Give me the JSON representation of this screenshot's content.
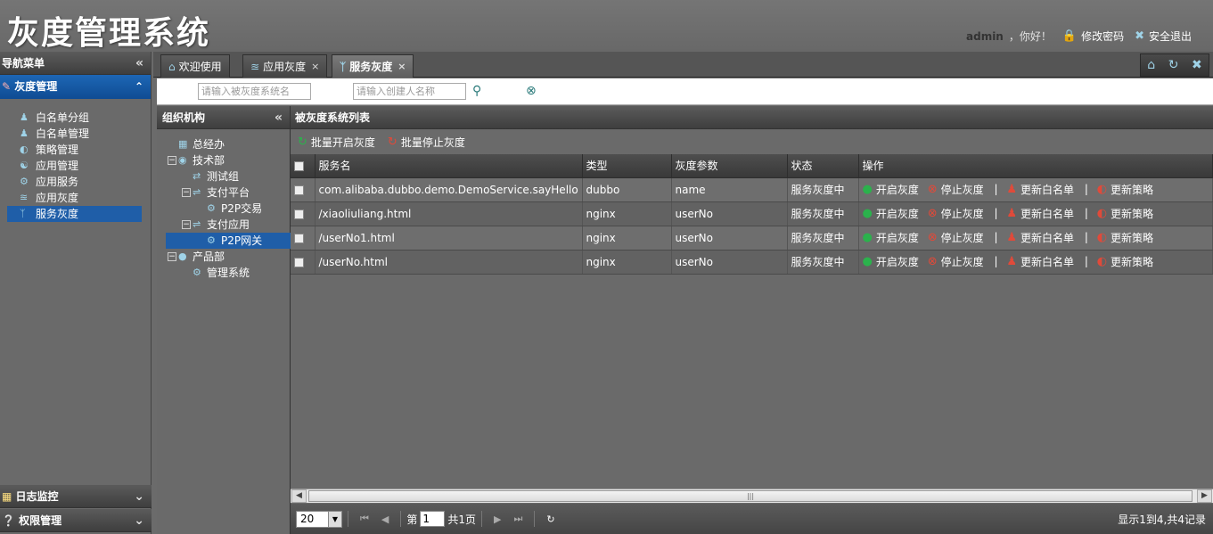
{
  "app": {
    "title": "灰度管理系统"
  },
  "user": {
    "name": "admin",
    "greeting": "，你好！",
    "change_password": "修改密码",
    "logout": "安全退出"
  },
  "nav": {
    "title": "导航菜单",
    "active_group": "灰度管理",
    "items": [
      {
        "label": "白名单分组",
        "icon": "users-icon"
      },
      {
        "label": "白名单管理",
        "icon": "people-icon"
      },
      {
        "label": "策略管理",
        "icon": "strategy-icon"
      },
      {
        "label": "应用管理",
        "icon": "globe-icon"
      },
      {
        "label": "应用服务",
        "icon": "service-icon"
      },
      {
        "label": "应用灰度",
        "icon": "rss-icon"
      },
      {
        "label": "服务灰度",
        "icon": "bluetooth-icon"
      }
    ],
    "bottom_groups": [
      {
        "label": "日志监控",
        "icon": "table-icon"
      },
      {
        "label": "权限管理",
        "icon": "help-icon"
      }
    ]
  },
  "tabs": [
    {
      "label": "欢迎使用",
      "icon": "home-icon"
    },
    {
      "label": "应用灰度",
      "icon": "rss-icon"
    },
    {
      "label": "服务灰度",
      "icon": "bluetooth-icon"
    }
  ],
  "search": {
    "system_placeholder": "请输入被灰度系统名",
    "creator_placeholder": "请输入创建人名称"
  },
  "org": {
    "title": "组织机构",
    "nodes": [
      {
        "label": "总经办"
      },
      {
        "label": "技术部"
      },
      {
        "label": "测试组"
      },
      {
        "label": "支付平台"
      },
      {
        "label": "P2P交易"
      },
      {
        "label": "支付应用"
      },
      {
        "label": "P2P网关"
      },
      {
        "label": "产品部"
      },
      {
        "label": "管理系统"
      }
    ]
  },
  "grid": {
    "title": "被灰度系统列表",
    "toolbar": {
      "batch_start": "批量开启灰度",
      "batch_stop": "批量停止灰度"
    },
    "columns": [
      "服务名",
      "类型",
      "灰度参数",
      "状态",
      "操作"
    ],
    "rows": [
      {
        "service": "com.alibaba.dubbo.demo.DemoService.sayHello",
        "type": "dubbo",
        "param": "name",
        "status": "服务灰度中"
      },
      {
        "service": "/xiaoliuliang.html",
        "type": "nginx",
        "param": "userNo",
        "status": "服务灰度中"
      },
      {
        "service": "/userNo1.html",
        "type": "nginx",
        "param": "userNo",
        "status": "服务灰度中"
      },
      {
        "service": "/userNo.html",
        "type": "nginx",
        "param": "userNo",
        "status": "服务灰度中"
      }
    ],
    "ops": {
      "start": "开启灰度",
      "stop": "停止灰度",
      "sep": "|",
      "whitelist": "更新白名单",
      "strategy": "更新策略"
    }
  },
  "pager": {
    "page_size": "20",
    "page_label": "第",
    "page_value": "1",
    "total_pages": "共1页",
    "info": "显示1到4,共4记录"
  },
  "colors": {
    "accent": "#1f5ea8",
    "start": "#2bb24c",
    "stop": "#e04a3a"
  }
}
